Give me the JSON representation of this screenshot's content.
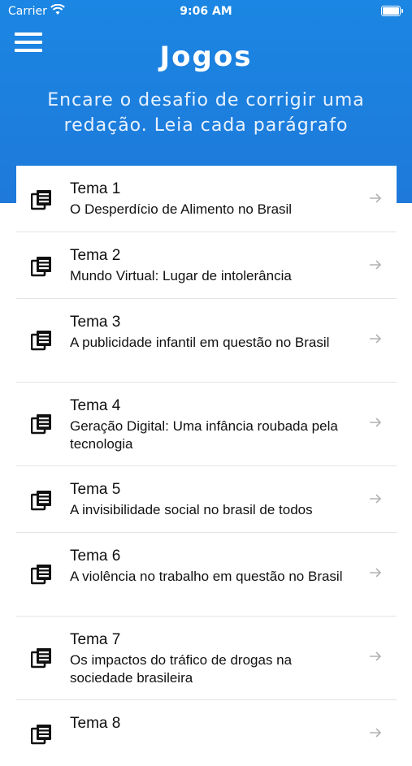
{
  "status": {
    "carrier": "Carrier",
    "time": "9:06 AM"
  },
  "header": {
    "title": "Jogos",
    "subtitle": "Encare o desafio de corrigir uma redação. Leia cada parágrafo"
  },
  "items": [
    {
      "label": "Tema 1",
      "desc": "O Desperdício de Alimento no Brasil"
    },
    {
      "label": "Tema 2",
      "desc": "Mundo Virtual: Lugar de intolerância"
    },
    {
      "label": "Tema 3",
      "desc": "A publicidade infantil em questão no Brasil"
    },
    {
      "label": "Tema 4",
      "desc": "Geração Digital: Uma infância roubada pela tecnologia"
    },
    {
      "label": "Tema 5",
      "desc": "A invisibilidade social no brasil de todos"
    },
    {
      "label": "Tema 6",
      "desc": "A violência no trabalho em questão no Brasil"
    },
    {
      "label": "Tema 7",
      "desc": "Os impactos do tráfico de drogas na sociedade brasileira"
    },
    {
      "label": "Tema 8",
      "desc": ""
    }
  ],
  "icons": {
    "item_icon": "news-list-icon",
    "arrow": "arrow-right-icon",
    "menu": "hamburger-menu-icon"
  },
  "colors": {
    "header_top": "#1b86e3",
    "header_bottom": "#1e79da",
    "text": "#111111",
    "divider": "#e3e3e3"
  }
}
